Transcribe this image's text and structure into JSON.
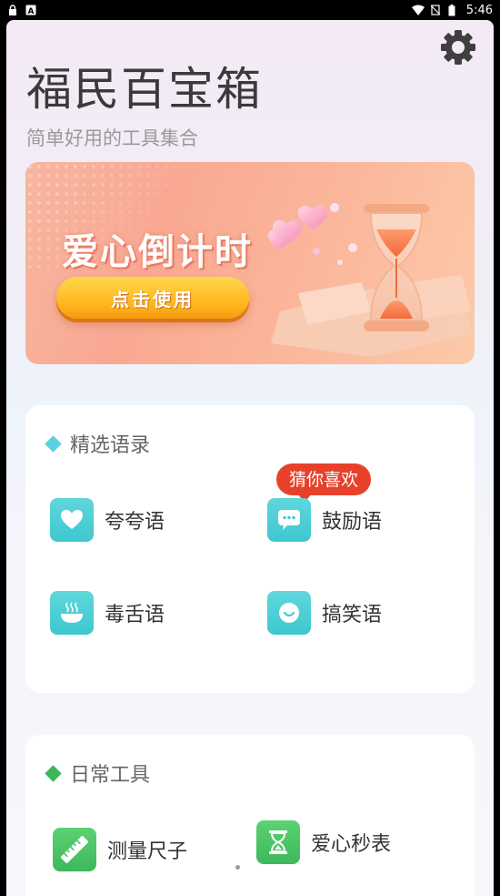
{
  "status_bar": {
    "time": "5:46",
    "left_icons": [
      "lock-icon",
      "a-notification-icon"
    ],
    "right_icons": [
      "wifi-icon",
      "sim-off-icon",
      "battery-icon"
    ]
  },
  "header": {
    "title": "福民百宝箱",
    "subtitle": "简单好用的工具集合",
    "settings_icon": "gear-icon"
  },
  "banner": {
    "title": "爱心倒计时",
    "button_label": "点击使用",
    "art": "hourglass-with-hearts"
  },
  "section_quotes": {
    "title": "精选语录",
    "accent_color": "#5ccfe0",
    "badge": "猜你喜欢",
    "items": [
      {
        "label": "夸夸语",
        "icon": "heart-icon"
      },
      {
        "label": "鼓励语",
        "icon": "chat-bubble-icon"
      },
      {
        "label": "毒舌语",
        "icon": "steaming-bowl-icon"
      },
      {
        "label": "搞笑语",
        "icon": "smile-icon"
      }
    ]
  },
  "section_tools": {
    "title": "日常工具",
    "accent_color": "#3eb65a",
    "items": [
      {
        "label": "测量尺子",
        "icon": "ruler-icon"
      },
      {
        "label": "爱心秒表",
        "icon": "hourglass-icon"
      }
    ]
  },
  "colors": {
    "badge": "#e8412b",
    "tile_teal": "#4ccdd5",
    "tile_green": "#46c064",
    "banner_button": "#ffb21c"
  }
}
